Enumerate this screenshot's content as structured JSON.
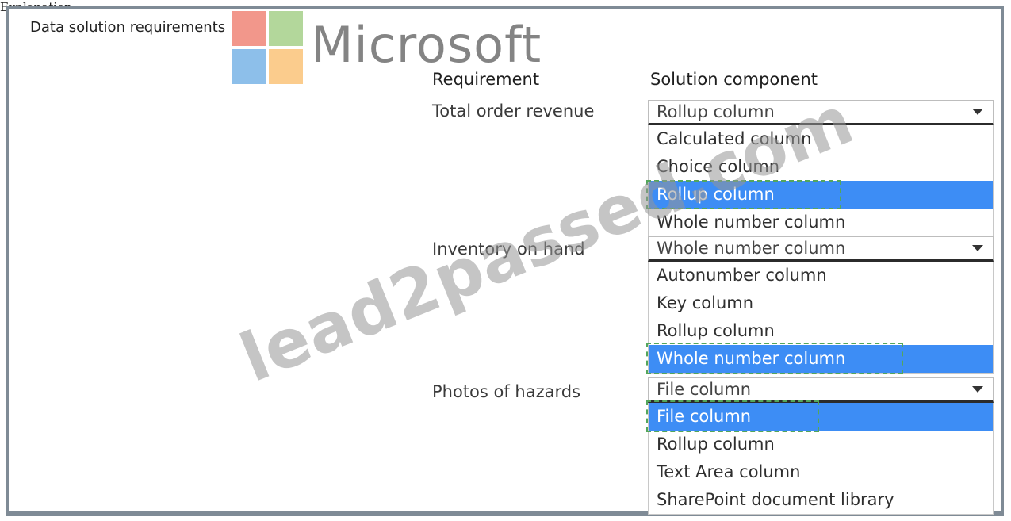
{
  "top_label": "Explanation:",
  "section_title": "Data solution requirements",
  "headers": {
    "requirement": "Requirement",
    "solution_component": "Solution component"
  },
  "watermark": {
    "brand": "Microsoft",
    "site": "lead2passed.com",
    "logo_colors": [
      "#e8412c",
      "#74b648",
      "#2f8ad8",
      "#f8a330"
    ]
  },
  "rows": [
    {
      "requirement": "Total order revenue",
      "selected": "Rollup column",
      "options": [
        {
          "label": "Calculated column"
        },
        {
          "label": "Choice column"
        },
        {
          "label": "Rollup column",
          "highlighted": true
        },
        {
          "label": "Whole number column"
        }
      ]
    },
    {
      "requirement": "Inventory on hand",
      "selected": "Whole number column",
      "options": [
        {
          "label": "Autonumber column"
        },
        {
          "label": "Key column"
        },
        {
          "label": "Rollup column"
        },
        {
          "label": "Whole number column",
          "highlighted": true
        }
      ]
    },
    {
      "requirement": "Photos of hazards",
      "selected": "File column",
      "options": [
        {
          "label": "File column",
          "highlighted": true
        },
        {
          "label": "Rollup column"
        },
        {
          "label": "Text Area column"
        },
        {
          "label": "SharePoint document library"
        }
      ]
    }
  ],
  "colors": {
    "highlight": "#3d8df5",
    "answer_outline": "#54a65b",
    "frame": "#7f8b96"
  }
}
